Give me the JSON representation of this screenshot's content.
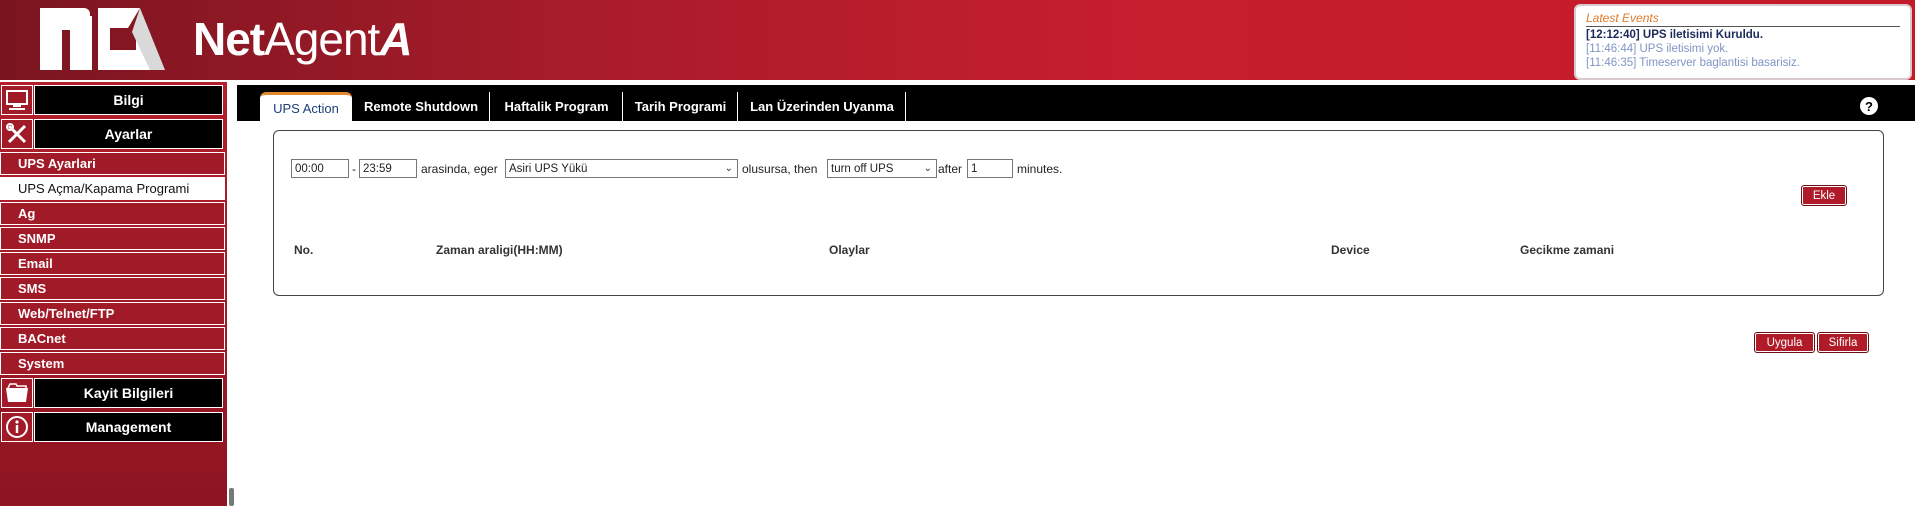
{
  "header": {
    "brand_part1": "Net",
    "brand_part2": "Agent",
    "brand_part3": "A",
    "events": {
      "title": "Latest Events",
      "lines": [
        "[12:12:40] UPS iletisimi Kuruldu.",
        "[11:46:44] UPS iletisimi yok.",
        "[11:46:35] Timeserver baglantisi basarisiz."
      ]
    }
  },
  "sidebar": {
    "heads": {
      "bilgi": "Bilgi",
      "ayarlar": "Ayarlar",
      "kayit": "Kayit Bilgileri",
      "management": "Management"
    },
    "items": [
      "UPS Ayarlari",
      "UPS Açma/Kapama Programi",
      "Ag",
      "SNMP",
      "Email",
      "SMS",
      "Web/Telnet/FTP",
      "BACnet",
      "System"
    ],
    "active_item": "UPS Açma/Kapama Programi"
  },
  "tabs": [
    "UPS Action",
    "Remote Shutdown",
    "Haftalik Program",
    "Tarih Programi",
    "Lan Üzerinden Uyanma"
  ],
  "active_tab": "UPS Action",
  "form": {
    "start_time": "00:00",
    "dash": "-",
    "end_time": "23:59",
    "text_between": "arasinda, eger",
    "event_select": "Asiri UPS Yükü",
    "text_if": "olusursa, then",
    "action_select": "turn off UPS",
    "text_after": "after",
    "delay_value": "1",
    "text_minutes": "minutes.",
    "add_button": "Ekle"
  },
  "table": {
    "columns": [
      "No.",
      "Zaman araligi(HH:MM)",
      "Olaylar",
      "Device",
      "Gecikme zamani"
    ]
  },
  "buttons": {
    "apply": "Uygula",
    "reset": "Sifirla"
  },
  "colors": {
    "brand_red": "#b01b29",
    "event_title": "#e07a2b",
    "tab_active_accent": "#e0892d"
  }
}
